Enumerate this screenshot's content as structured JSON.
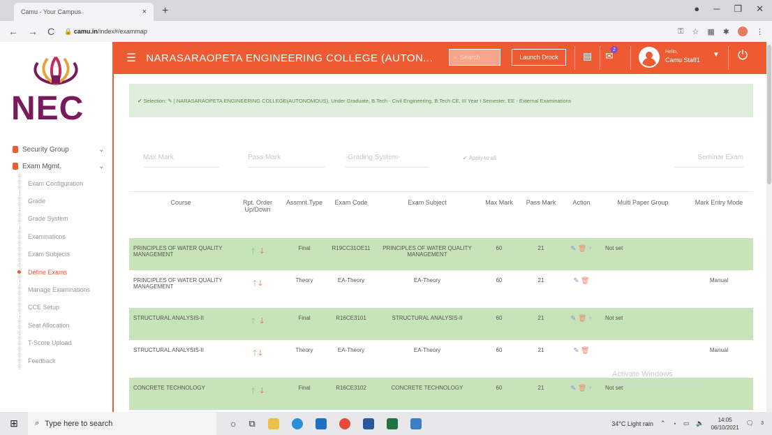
{
  "browser": {
    "tab_title": "Camu - Your Campus",
    "tab_close": "×",
    "new_tab": "+",
    "url_host": "camu.in",
    "url_path": "/index#/exammap",
    "back": "←",
    "forward": "→",
    "reload": "C"
  },
  "logo": {
    "text": "NEC"
  },
  "sidebar": {
    "groups": [
      {
        "label": "Security Group",
        "chevron": "⌄"
      },
      {
        "label": "Exam Mgmt.",
        "chevron": "⌄"
      }
    ],
    "items": [
      {
        "label": "Exam Configuration"
      },
      {
        "label": "Grade"
      },
      {
        "label": "Grade System"
      },
      {
        "label": "Examinations"
      },
      {
        "label": "Exam Subjects"
      },
      {
        "label": "Define Exams"
      },
      {
        "label": "Manage Examinations"
      },
      {
        "label": "CCE Setup"
      },
      {
        "label": "Seat Allocation"
      },
      {
        "label": "T-Score Upload"
      },
      {
        "label": "Feedback"
      }
    ],
    "active_item": "Define Exams"
  },
  "header": {
    "college": "NARASARAOPETA ENGINEERING COLLEGE (AUTON...",
    "search_placeholder": "Search",
    "launch_button": "Launch Drock",
    "mail_badge": "2",
    "hello": "Hello,",
    "user": "Camu Staff1",
    "accent": "#ee5a32"
  },
  "selection": {
    "text": "✔ Selection: ✎ | NARASARAOPETA ENGINEERING COLLEGE(AUTONOMOUS), Under Graduate, B.Tech - Civil Engineering, B.Tech CE, III Year I Semester, EE - External Examinations"
  },
  "filters": {
    "max_mark": "Max Mark",
    "pass_mark": "Pass Mark",
    "grading_system": "-Grading System-",
    "apply_all": "✔ Apply to all",
    "dropdown_right": "Seminar Exam"
  },
  "table": {
    "headers": [
      "Course",
      "Rpt. Order Up/Down",
      "Assmnt.Type",
      "Exam Code",
      "Exam Subject",
      "Max Mark",
      "Pass Mark",
      "Action",
      "Multi Paper Group",
      "Mark Entry Mode"
    ],
    "rows": [
      {
        "course": "PRINCIPLES OF WATER QUALITY MANAGEMENT",
        "type": "Final",
        "code": "R19CC31OE11",
        "subject": "PRINCIPLES OF WATER QUALITY MANAGEMENT",
        "max": "60",
        "pass": "21",
        "group": "Not set",
        "mode": "",
        "final": true
      },
      {
        "course": "PRINCIPLES OF WATER QUALITY MANAGEMENT",
        "type": "Theory",
        "code": "EA-Theory",
        "subject": "EA-Theory",
        "max": "60",
        "pass": "21",
        "group": "",
        "mode": "Manual",
        "final": false
      },
      {
        "course": "STRUCTURAL ANALYSIS-II",
        "type": "Final",
        "code": "R16CE3101",
        "subject": "STRUCTURAL ANALYSIS-II",
        "max": "60",
        "pass": "21",
        "group": "Not set",
        "mode": "",
        "final": true
      },
      {
        "course": "STRUCTURAL ANALYSIS-II",
        "type": "Theory",
        "code": "EA-Theory",
        "subject": "EA-Theory",
        "max": "60",
        "pass": "21",
        "group": "",
        "mode": "Manual",
        "final": false
      },
      {
        "course": "CONCRETE TECHNOLOGY",
        "type": "Final",
        "code": "R16CE3102",
        "subject": "CONCRETE TECHNOLOGY",
        "max": "60",
        "pass": "21",
        "group": "Not set",
        "mode": "",
        "final": true
      }
    ]
  },
  "watermark": {
    "line1": "Activate Windows",
    "line2": "Go to Settings to activate Windows."
  },
  "taskbar": {
    "search": "Type here to search",
    "weather": "34°C  Light rain",
    "time": "14:05",
    "date": "06/10/2021",
    "notif_count": "3"
  }
}
